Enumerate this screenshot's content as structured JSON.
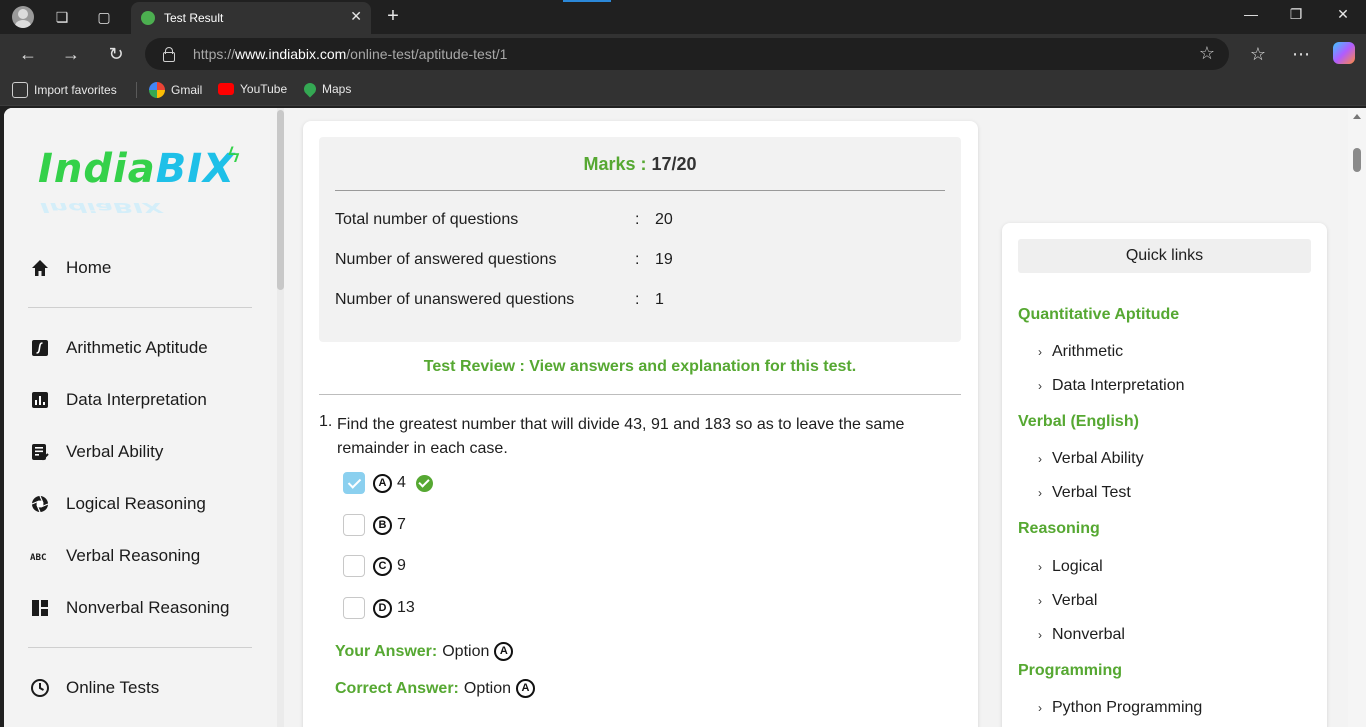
{
  "browser": {
    "tab_title": "Test Result",
    "url_prefix": "https://",
    "url_domain": "www.indiabix.com",
    "url_path": "/online-test/aptitude-test/1",
    "favorites": [
      {
        "label": "Import favorites",
        "icon": "import-icon"
      },
      {
        "label": "Gmail",
        "icon": "google-icon"
      },
      {
        "label": "YouTube",
        "icon": "youtube-icon"
      },
      {
        "label": "Maps",
        "icon": "maps-icon"
      }
    ]
  },
  "logo": {
    "part1": "India",
    "part2": "BIX"
  },
  "sidebar": {
    "items": [
      {
        "label": "Home",
        "icon": "home-icon"
      },
      {
        "label": "Arithmetic Aptitude",
        "icon": "function-icon"
      },
      {
        "label": "Data Interpretation",
        "icon": "bar-chart-icon"
      },
      {
        "label": "Verbal Ability",
        "icon": "checklist-icon"
      },
      {
        "label": "Logical Reasoning",
        "icon": "aperture-icon"
      },
      {
        "label": "Verbal Reasoning",
        "icon": "abc-icon"
      },
      {
        "label": "Nonverbal Reasoning",
        "icon": "dashboard-icon"
      },
      {
        "label": "Online Tests",
        "icon": "clock-icon"
      }
    ]
  },
  "result": {
    "marks_label": "Marks :",
    "marks_value": "17/20",
    "stats": [
      {
        "label": "Total number of questions",
        "value": "20"
      },
      {
        "label": "Number of answered questions",
        "value": "19"
      },
      {
        "label": "Number of unanswered questions",
        "value": "1"
      }
    ],
    "review_text": "Test Review : View answers and explanation for this test."
  },
  "question": {
    "number": "1.",
    "text": "Find the greatest number that will divide 43, 91 and 183 so as to leave the same remainder in each case.",
    "options": [
      {
        "letter": "A",
        "text": "4",
        "checked": true,
        "correct": true
      },
      {
        "letter": "B",
        "text": "7",
        "checked": false,
        "correct": false
      },
      {
        "letter": "C",
        "text": "9",
        "checked": false,
        "correct": false
      },
      {
        "letter": "D",
        "text": "13",
        "checked": false,
        "correct": false
      }
    ],
    "your_answer_label": "Your Answer:",
    "your_answer_text": "Option",
    "your_answer_letter": "A",
    "correct_answer_label": "Correct Answer:",
    "correct_answer_text": "Option",
    "correct_answer_letter": "A"
  },
  "quick_links": {
    "title": "Quick links",
    "categories": [
      {
        "name": "Quantitative Aptitude",
        "links": [
          "Arithmetic",
          "Data Interpretation"
        ]
      },
      {
        "name": "Verbal (English)",
        "links": [
          "Verbal Ability",
          "Verbal Test"
        ]
      },
      {
        "name": "Reasoning",
        "links": [
          "Logical",
          "Verbal",
          "Nonverbal"
        ]
      },
      {
        "name": "Programming",
        "links": [
          "Python Programming"
        ]
      }
    ]
  },
  "colors": {
    "accent_green": "#56a832",
    "logo_green": "#34d14a",
    "logo_blue": "#1ec0e8"
  }
}
